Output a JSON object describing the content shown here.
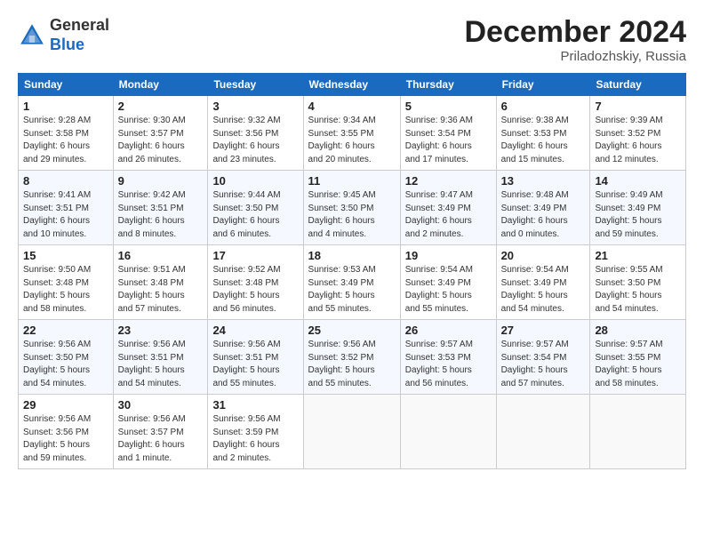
{
  "header": {
    "logo_general": "General",
    "logo_blue": "Blue",
    "month_title": "December 2024",
    "location": "Priladozhskiy, Russia"
  },
  "days_of_week": [
    "Sunday",
    "Monday",
    "Tuesday",
    "Wednesday",
    "Thursday",
    "Friday",
    "Saturday"
  ],
  "weeks": [
    [
      {
        "day": "1",
        "info": "Sunrise: 9:28 AM\nSunset: 3:58 PM\nDaylight: 6 hours\nand 29 minutes."
      },
      {
        "day": "2",
        "info": "Sunrise: 9:30 AM\nSunset: 3:57 PM\nDaylight: 6 hours\nand 26 minutes."
      },
      {
        "day": "3",
        "info": "Sunrise: 9:32 AM\nSunset: 3:56 PM\nDaylight: 6 hours\nand 23 minutes."
      },
      {
        "day": "4",
        "info": "Sunrise: 9:34 AM\nSunset: 3:55 PM\nDaylight: 6 hours\nand 20 minutes."
      },
      {
        "day": "5",
        "info": "Sunrise: 9:36 AM\nSunset: 3:54 PM\nDaylight: 6 hours\nand 17 minutes."
      },
      {
        "day": "6",
        "info": "Sunrise: 9:38 AM\nSunset: 3:53 PM\nDaylight: 6 hours\nand 15 minutes."
      },
      {
        "day": "7",
        "info": "Sunrise: 9:39 AM\nSunset: 3:52 PM\nDaylight: 6 hours\nand 12 minutes."
      }
    ],
    [
      {
        "day": "8",
        "info": "Sunrise: 9:41 AM\nSunset: 3:51 PM\nDaylight: 6 hours\nand 10 minutes."
      },
      {
        "day": "9",
        "info": "Sunrise: 9:42 AM\nSunset: 3:51 PM\nDaylight: 6 hours\nand 8 minutes."
      },
      {
        "day": "10",
        "info": "Sunrise: 9:44 AM\nSunset: 3:50 PM\nDaylight: 6 hours\nand 6 minutes."
      },
      {
        "day": "11",
        "info": "Sunrise: 9:45 AM\nSunset: 3:50 PM\nDaylight: 6 hours\nand 4 minutes."
      },
      {
        "day": "12",
        "info": "Sunrise: 9:47 AM\nSunset: 3:49 PM\nDaylight: 6 hours\nand 2 minutes."
      },
      {
        "day": "13",
        "info": "Sunrise: 9:48 AM\nSunset: 3:49 PM\nDaylight: 6 hours\nand 0 minutes."
      },
      {
        "day": "14",
        "info": "Sunrise: 9:49 AM\nSunset: 3:49 PM\nDaylight: 5 hours\nand 59 minutes."
      }
    ],
    [
      {
        "day": "15",
        "info": "Sunrise: 9:50 AM\nSunset: 3:48 PM\nDaylight: 5 hours\nand 58 minutes."
      },
      {
        "day": "16",
        "info": "Sunrise: 9:51 AM\nSunset: 3:48 PM\nDaylight: 5 hours\nand 57 minutes."
      },
      {
        "day": "17",
        "info": "Sunrise: 9:52 AM\nSunset: 3:48 PM\nDaylight: 5 hours\nand 56 minutes."
      },
      {
        "day": "18",
        "info": "Sunrise: 9:53 AM\nSunset: 3:49 PM\nDaylight: 5 hours\nand 55 minutes."
      },
      {
        "day": "19",
        "info": "Sunrise: 9:54 AM\nSunset: 3:49 PM\nDaylight: 5 hours\nand 55 minutes."
      },
      {
        "day": "20",
        "info": "Sunrise: 9:54 AM\nSunset: 3:49 PM\nDaylight: 5 hours\nand 54 minutes."
      },
      {
        "day": "21",
        "info": "Sunrise: 9:55 AM\nSunset: 3:50 PM\nDaylight: 5 hours\nand 54 minutes."
      }
    ],
    [
      {
        "day": "22",
        "info": "Sunrise: 9:56 AM\nSunset: 3:50 PM\nDaylight: 5 hours\nand 54 minutes."
      },
      {
        "day": "23",
        "info": "Sunrise: 9:56 AM\nSunset: 3:51 PM\nDaylight: 5 hours\nand 54 minutes."
      },
      {
        "day": "24",
        "info": "Sunrise: 9:56 AM\nSunset: 3:51 PM\nDaylight: 5 hours\nand 55 minutes."
      },
      {
        "day": "25",
        "info": "Sunrise: 9:56 AM\nSunset: 3:52 PM\nDaylight: 5 hours\nand 55 minutes."
      },
      {
        "day": "26",
        "info": "Sunrise: 9:57 AM\nSunset: 3:53 PM\nDaylight: 5 hours\nand 56 minutes."
      },
      {
        "day": "27",
        "info": "Sunrise: 9:57 AM\nSunset: 3:54 PM\nDaylight: 5 hours\nand 57 minutes."
      },
      {
        "day": "28",
        "info": "Sunrise: 9:57 AM\nSunset: 3:55 PM\nDaylight: 5 hours\nand 58 minutes."
      }
    ],
    [
      {
        "day": "29",
        "info": "Sunrise: 9:56 AM\nSunset: 3:56 PM\nDaylight: 5 hours\nand 59 minutes."
      },
      {
        "day": "30",
        "info": "Sunrise: 9:56 AM\nSunset: 3:57 PM\nDaylight: 6 hours\nand 1 minute."
      },
      {
        "day": "31",
        "info": "Sunrise: 9:56 AM\nSunset: 3:59 PM\nDaylight: 6 hours\nand 2 minutes."
      },
      {
        "day": "",
        "info": ""
      },
      {
        "day": "",
        "info": ""
      },
      {
        "day": "",
        "info": ""
      },
      {
        "day": "",
        "info": ""
      }
    ]
  ]
}
